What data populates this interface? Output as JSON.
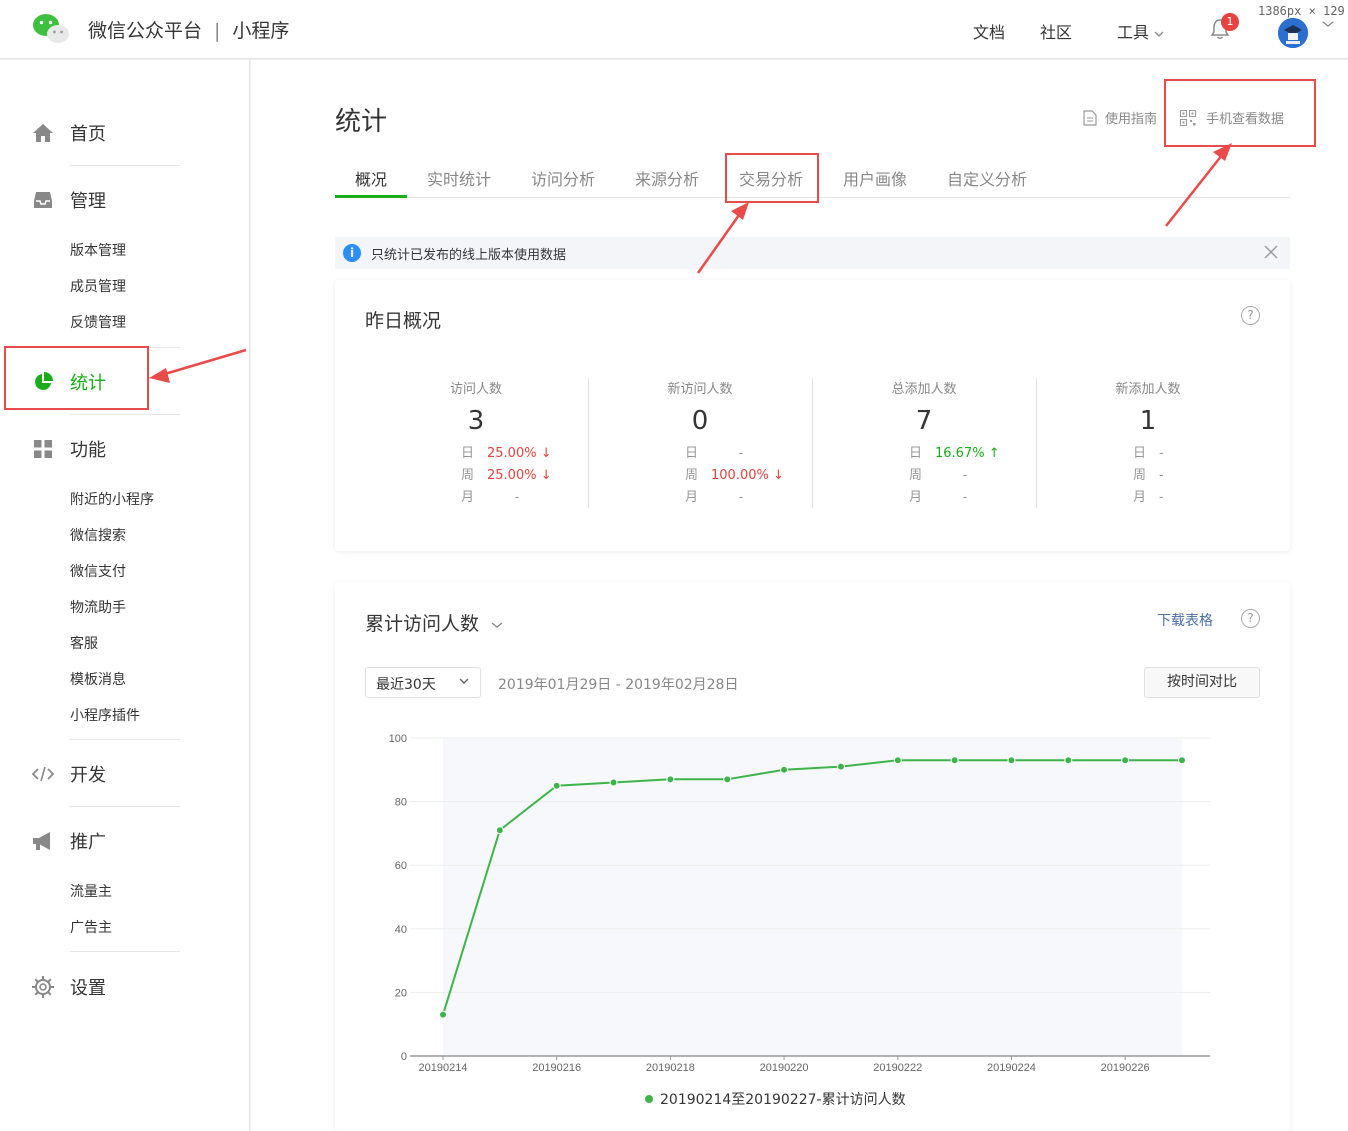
{
  "header": {
    "brand_main": "微信公众平台",
    "brand_sep": "|",
    "brand_sub": "小程序",
    "nav": [
      "文档",
      "社区",
      "工具"
    ],
    "notification_count": "1",
    "dimension_tip": "1386px × 129"
  },
  "sidebar": {
    "sections": [
      {
        "label": "首页",
        "icon": "home-icon"
      },
      {
        "label": "管理",
        "icon": "inbox-icon",
        "items": [
          "版本管理",
          "成员管理",
          "反馈管理"
        ]
      },
      {
        "label": "统计",
        "icon": "pie-chart-icon",
        "active": true
      },
      {
        "label": "功能",
        "icon": "grid-icon",
        "items": [
          "附近的小程序",
          "微信搜索",
          "微信支付",
          "物流助手",
          "客服",
          "模板消息",
          "小程序插件"
        ]
      },
      {
        "label": "开发",
        "icon": "code-icon"
      },
      {
        "label": "推广",
        "icon": "megaphone-icon",
        "items": [
          "流量主",
          "广告主"
        ]
      },
      {
        "label": "设置",
        "icon": "gear-icon"
      }
    ]
  },
  "page": {
    "title": "统计",
    "guide_label": "使用指南",
    "mobile_label": "手机查看数据",
    "tabs": [
      "概况",
      "实时统计",
      "访问分析",
      "来源分析",
      "交易分析",
      "用户画像",
      "自定义分析"
    ],
    "active_tab": "概况"
  },
  "notice": {
    "text": "只统计已发布的线上版本使用数据"
  },
  "overview": {
    "title": "昨日概况",
    "help": "?",
    "row_keys": [
      "日",
      "周",
      "月"
    ],
    "metrics": [
      {
        "label": "访问人数",
        "value": "3",
        "day": "25.00%",
        "day_trend": "down",
        "week": "25.00%",
        "week_trend": "down",
        "month": "-"
      },
      {
        "label": "新访问人数",
        "value": "0",
        "day": "-",
        "week": "100.00%",
        "week_trend": "down",
        "month": "-"
      },
      {
        "label": "总添加人数",
        "value": "7",
        "day": "16.67%",
        "day_trend": "up",
        "week": "-",
        "month": "-"
      },
      {
        "label": "新添加人数",
        "value": "1",
        "day": "-",
        "week": "-",
        "month": "-"
      }
    ]
  },
  "trend": {
    "title": "累计访问人数",
    "download": "下载表格",
    "help": "?",
    "range_select": "最近30天",
    "date_range": "2019年01月29日 - 2019年02月28日",
    "compare_button": "按时间对比"
  },
  "chart_data": {
    "type": "line",
    "x": [
      "20190214",
      "20190215",
      "20190216",
      "20190217",
      "20190218",
      "20190219",
      "20190220",
      "20190221",
      "20190222",
      "20190223",
      "20190224",
      "20190225",
      "20190226",
      "20190227"
    ],
    "x_tick_labels": [
      "20190214",
      "20190216",
      "20190218",
      "20190220",
      "20190222",
      "20190224",
      "20190226"
    ],
    "series": [
      {
        "name": "20190214至20190227-累计访问人数",
        "values": [
          13,
          71,
          85,
          86,
          87,
          87,
          90,
          91,
          93,
          93,
          93,
          93,
          93,
          93
        ],
        "color": "#3db44a"
      }
    ],
    "ylim": [
      0,
      100
    ],
    "yticks": [
      0,
      20,
      40,
      60,
      80,
      100
    ],
    "grid": true,
    "legend": "bottom-center"
  },
  "colors": {
    "accent": "#1aad19",
    "down": "#e64340",
    "annotation": "#e94b4b",
    "link": "#4a6ea8"
  }
}
